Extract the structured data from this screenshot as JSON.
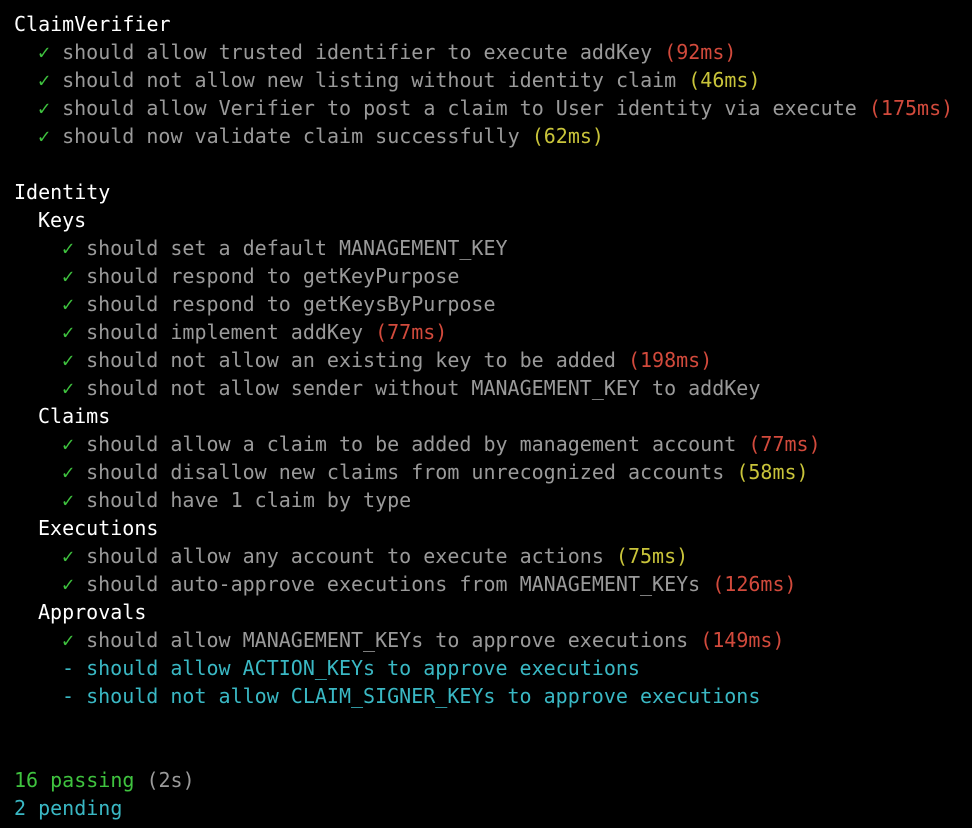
{
  "suites": {
    "claimverifier": {
      "title": "ClaimVerifier",
      "tests": [
        {
          "check": "✓",
          "title": "should allow trusted identifier to execute addKey",
          "duration": "(92ms)",
          "speed": "slow"
        },
        {
          "check": "✓",
          "title": "should not allow new listing without identity claim",
          "duration": "(46ms)",
          "speed": "medium"
        },
        {
          "check": "✓",
          "title": "should allow Verifier to post a claim to User identity via execute",
          "duration": "(175ms)",
          "speed": "slow"
        },
        {
          "check": "✓",
          "title": "should now validate claim successfully",
          "duration": "(62ms)",
          "speed": "medium"
        }
      ]
    },
    "identity": {
      "title": "Identity",
      "keys": {
        "title": "Keys",
        "tests": [
          {
            "check": "✓",
            "title": "should set a default MANAGEMENT_KEY"
          },
          {
            "check": "✓",
            "title": "should respond to getKeyPurpose"
          },
          {
            "check": "✓",
            "title": "should respond to getKeysByPurpose"
          },
          {
            "check": "✓",
            "title": "should implement addKey",
            "duration": "(77ms)",
            "speed": "slow"
          },
          {
            "check": "✓",
            "title": "should not allow an existing key to be added",
            "duration": "(198ms)",
            "speed": "slow"
          },
          {
            "check": "✓",
            "title": "should not allow sender without MANAGEMENT_KEY to addKey"
          }
        ]
      },
      "claims": {
        "title": "Claims",
        "tests": [
          {
            "check": "✓",
            "title": "should allow a claim to be added by management account",
            "duration": "(77ms)",
            "speed": "slow"
          },
          {
            "check": "✓",
            "title": "should disallow new claims from unrecognized accounts",
            "duration": "(58ms)",
            "speed": "medium"
          },
          {
            "check": "✓",
            "title": "should have 1 claim by type"
          }
        ]
      },
      "executions": {
        "title": "Executions",
        "tests": [
          {
            "check": "✓",
            "title": "should allow any account to execute actions",
            "duration": "(75ms)",
            "speed": "medium"
          },
          {
            "check": "✓",
            "title": "should auto-approve executions from MANAGEMENT_KEYs",
            "duration": "(126ms)",
            "speed": "slow"
          }
        ]
      },
      "approvals": {
        "title": "Approvals",
        "tests": [
          {
            "check": "✓",
            "title": "should allow MANAGEMENT_KEYs to approve executions",
            "duration": "(149ms)",
            "speed": "slow"
          }
        ],
        "pending": [
          "- should allow ACTION_KEYs to approve executions",
          "- should not allow CLAIM_SIGNER_KEYs to approve executions"
        ]
      }
    }
  },
  "summary": {
    "passing": "16 passing",
    "time": "(2s)",
    "pending": "2 pending"
  },
  "colors": {
    "background": "#000000",
    "suite_title": "#ffffff",
    "test_text": "#9a9a9a",
    "pass_check": "#3fc33f",
    "duration_slow": "#d24a3c",
    "duration_medium": "#c9c43a",
    "pending": "#3ab8c4"
  }
}
